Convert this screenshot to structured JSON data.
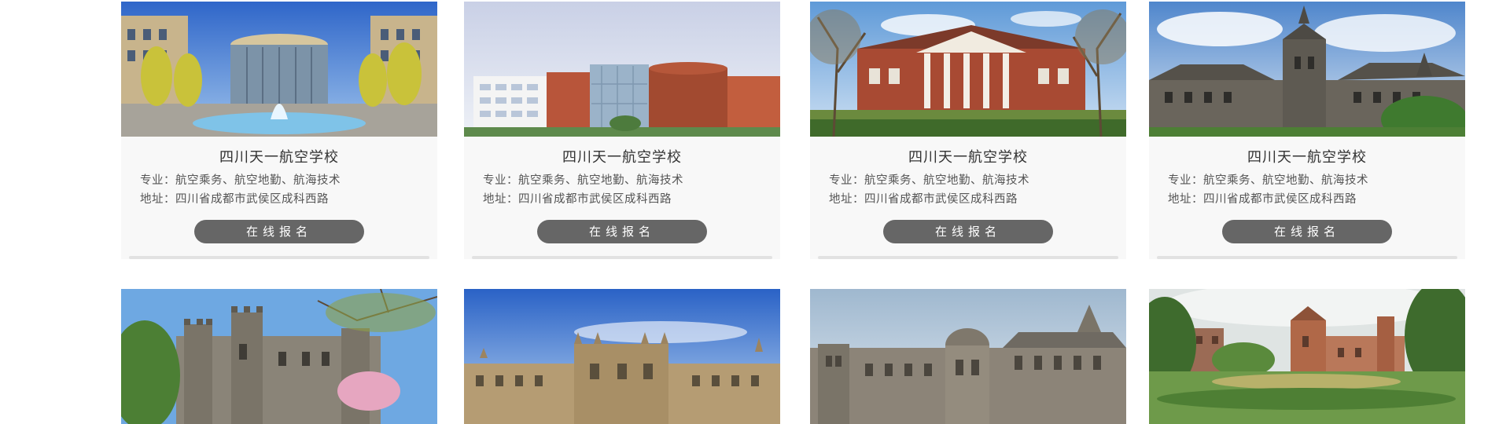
{
  "schools": [
    {
      "name": "四川天一航空学校",
      "major": "专业：航空乘务、航空地勤、航海技术",
      "address": "地址：四川省成都市武侯区成科西路",
      "button": "在线报名"
    },
    {
      "name": "四川天一航空学校",
      "major": "专业：航空乘务、航空地勤、航海技术",
      "address": "地址：四川省成都市武侯区成科西路",
      "button": "在线报名"
    },
    {
      "name": "四川天一航空学校",
      "major": "专业：航空乘务、航空地勤、航海技术",
      "address": "地址：四川省成都市武侯区成科西路",
      "button": "在线报名"
    },
    {
      "name": "四川天一航空学校",
      "major": "专业：航空乘务、航空地勤、航海技术",
      "address": "地址：四川省成都市武侯区成科西路",
      "button": "在线报名"
    }
  ],
  "colors": {
    "card_background": "#f8f8f8",
    "button_background": "#666666",
    "button_text": "#ffffff",
    "title_text": "#333333",
    "body_text": "#555555"
  }
}
